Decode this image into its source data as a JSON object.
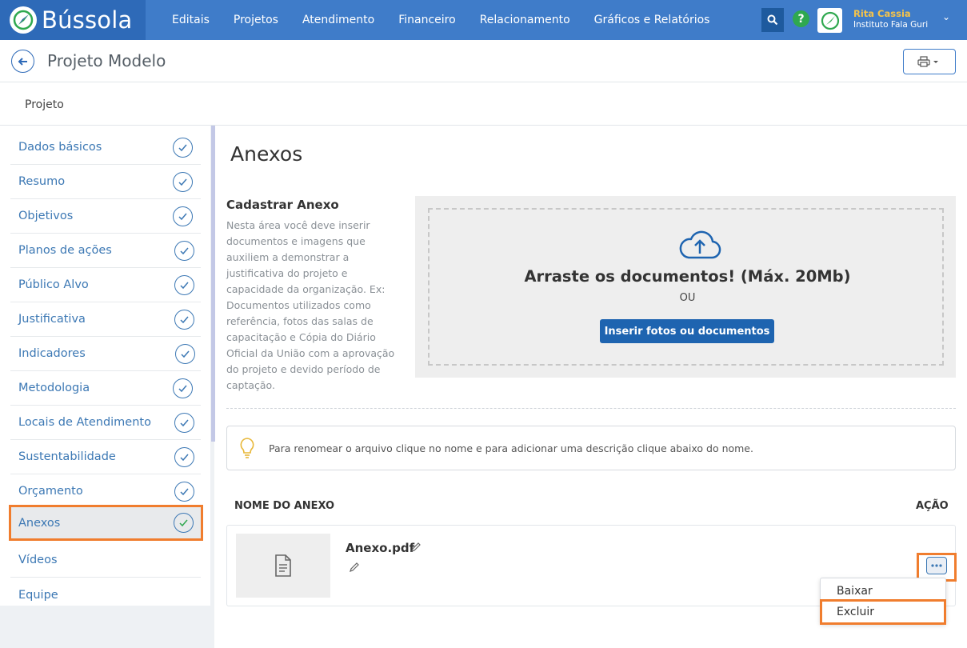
{
  "app": {
    "name": "Bússola",
    "nav": [
      "Editais",
      "Projetos",
      "Atendimento",
      "Financeiro",
      "Relacionamento",
      "Gráficos e Relatórios"
    ],
    "user_name": "Rita Cassia",
    "user_org": "Instituto Fala Guri"
  },
  "page": {
    "title": "Projeto Modelo",
    "breadcrumb": "Projeto"
  },
  "sidebar": {
    "items": [
      {
        "label": "Dados básicos",
        "done": true
      },
      {
        "label": "Resumo",
        "done": true
      },
      {
        "label": "Objetivos",
        "done": true
      },
      {
        "label": "Planos de ações",
        "done": true
      },
      {
        "label": "Público Alvo",
        "done": true
      },
      {
        "label": "Justificativa",
        "done": true
      },
      {
        "label": "Indicadores",
        "done": true
      },
      {
        "label": "Metodologia",
        "done": true
      },
      {
        "label": "Locais de Atendimento",
        "done": true
      },
      {
        "label": "Sustentabilidade",
        "done": true
      },
      {
        "label": "Orçamento",
        "done": true
      },
      {
        "label": "Anexos",
        "done": true,
        "active": true
      },
      {
        "label": "Vídeos",
        "done": false
      },
      {
        "label": "Equipe",
        "done": false
      }
    ]
  },
  "main": {
    "title": "Anexos",
    "cadastrar_title": "Cadastrar Anexo",
    "cadastrar_desc": "Nesta área você deve inserir documentos e imagens que auxiliem a demonstrar a justificativa do projeto e capacidade da organização. Ex: Documentos utilizados como referência, fotos das salas de capacitação e Cópia do Diário Oficial da União com a aprovação do projeto e devido período de captação.",
    "drop_title": "Arraste os documentos! (Máx. 20Mb)",
    "drop_or": "OU",
    "insert_button": "Inserir fotos ou documentos",
    "tip": "Para renomear o arquivo clique no nome e para adicionar uma descrição clique abaixo do nome.",
    "col_name": "NOME DO ANEXO",
    "col_action": "AÇÃO",
    "file_name": "Anexo.pdf",
    "action_menu": [
      "Baixar",
      "Excluir"
    ]
  },
  "colors": {
    "topbar": "#3f7cc9",
    "accent": "#1e64b0",
    "highlight": "#f07d2e"
  }
}
